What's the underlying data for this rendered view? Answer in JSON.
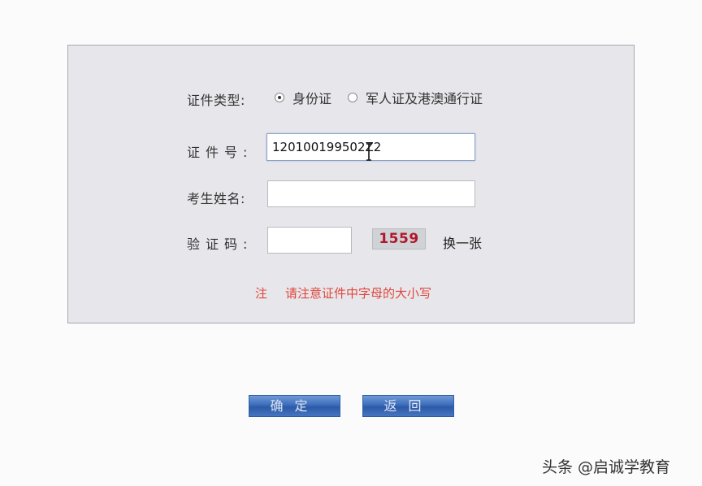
{
  "form": {
    "id_type_label": "证件类型:",
    "id_type_options": [
      {
        "label": "身份证",
        "selected": true
      },
      {
        "label": "军人证及港澳通行证",
        "selected": false
      }
    ],
    "id_number_label": "证件号:",
    "id_number_value": "120100199502Z2",
    "name_label": "考生姓名:",
    "name_value": "",
    "captcha_label": "验证码:",
    "captcha_value": "",
    "captcha_image_text": "1559",
    "refresh_link": "换一张",
    "note_prefix": "注",
    "note_text": "请注意证件中字母的大小写"
  },
  "buttons": {
    "confirm_label": "确定",
    "back_label": "返回"
  },
  "watermark": "头条 @启诚学教育",
  "colors": {
    "panel_bg": "#e7e7eb",
    "note_red": "#e0463c",
    "captcha_red": "#b3162b",
    "button_blue": "#3d6dbb"
  },
  "icons": {
    "radio_checked": "radio-checked-icon",
    "radio_unchecked": "radio-unchecked-icon",
    "text_cursor": "ibeam-cursor-icon"
  }
}
